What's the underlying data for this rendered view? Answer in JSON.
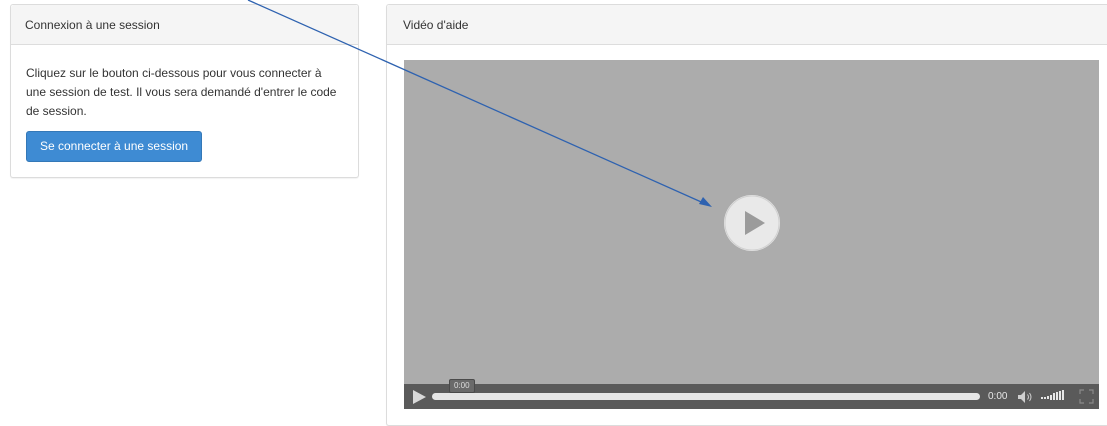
{
  "left_panel": {
    "title": "Connexion à une session",
    "description": "Cliquez sur le bouton ci-dessous pour vous connecter à une session de test. Il vous sera demandé d'entrer le code de session.",
    "button_label": "Se connecter à une session"
  },
  "right_panel": {
    "title": "Vidéo d'aide"
  },
  "video": {
    "time_bubble": "0:00",
    "current_time": "0:00",
    "icons": {
      "big_play": "play-circle-icon",
      "play": "play-icon",
      "volume": "speaker-icon",
      "volume_level": "volume-bars-icon",
      "fullscreen": "fullscreen-icon"
    }
  },
  "colors": {
    "primary_button": "#3e8bd3",
    "video_background": "#acacac",
    "controls_background": "#5a5a5a",
    "annotation_arrow": "#2e62b0"
  }
}
